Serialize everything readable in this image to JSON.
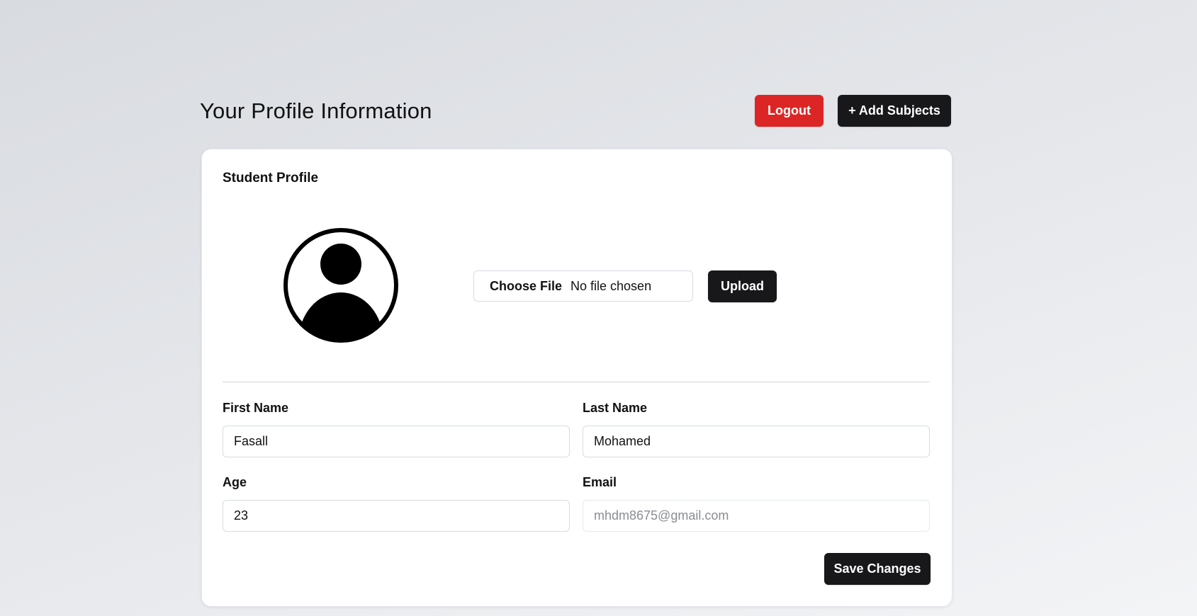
{
  "header": {
    "title": "Your Profile Information",
    "logout_label": "Logout",
    "add_subjects_label": "+ Add Subjects"
  },
  "card": {
    "title": "Student Profile",
    "avatar_icon": "user-circle-icon",
    "file_input": {
      "button_label": "Choose File",
      "status": "No file chosen"
    },
    "upload_label": "Upload"
  },
  "form": {
    "first_name": {
      "label": "First Name",
      "value": "Fasall"
    },
    "last_name": {
      "label": "Last Name",
      "value": "Mohamed"
    },
    "age": {
      "label": "Age",
      "value": "23"
    },
    "email": {
      "label": "Email",
      "value": "mhdm8675@gmail.com",
      "disabled": true
    }
  },
  "save_label": "Save Changes",
  "colors": {
    "logout": "#dc2626",
    "primary_dark": "#18181b",
    "background": "#e4e6ea"
  }
}
